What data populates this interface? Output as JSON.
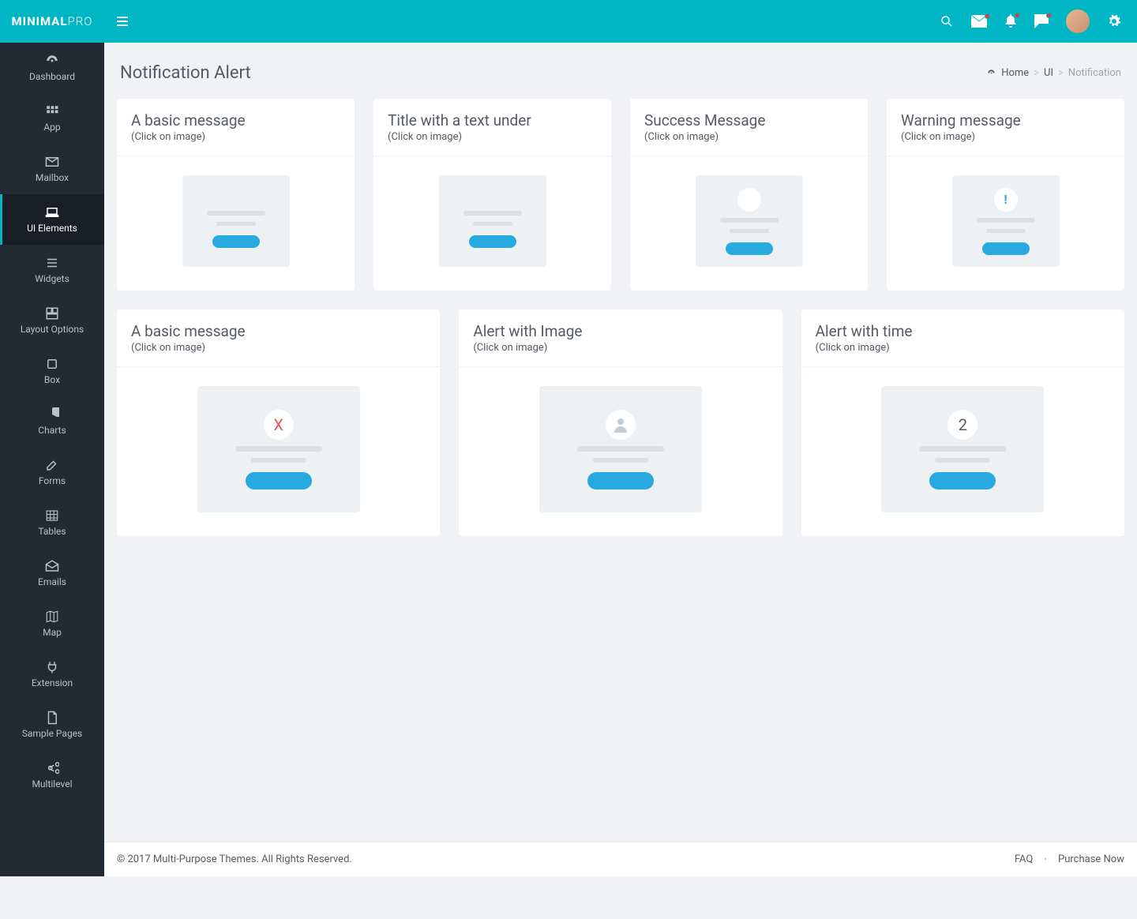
{
  "brand": {
    "part1": "MINIMAL",
    "part2": "PRO"
  },
  "nav": [
    {
      "label": "Dashboard",
      "icon": "dashboard"
    },
    {
      "label": "App",
      "icon": "grid"
    },
    {
      "label": "Mailbox",
      "icon": "envelope"
    },
    {
      "label": "UI Elements",
      "icon": "laptop",
      "active": true
    },
    {
      "label": "Widgets",
      "icon": "bars"
    },
    {
      "label": "Layout Options",
      "icon": "layout"
    },
    {
      "label": "Box",
      "icon": "box"
    },
    {
      "label": "Charts",
      "icon": "pie"
    },
    {
      "label": "Forms",
      "icon": "edit"
    },
    {
      "label": "Tables",
      "icon": "table"
    },
    {
      "label": "Emails",
      "icon": "mailopen"
    },
    {
      "label": "Map",
      "icon": "map"
    },
    {
      "label": "Extension",
      "icon": "plug"
    },
    {
      "label": "Sample Pages",
      "icon": "file"
    },
    {
      "label": "Multilevel",
      "icon": "share"
    }
  ],
  "page": {
    "title": "Notification Alert"
  },
  "breadcrumb": {
    "home": "Home",
    "mid": "UI",
    "leaf": "Notification"
  },
  "cards_row1": [
    {
      "title": "A basic message",
      "sub": "(Click on image)",
      "variant": "plain"
    },
    {
      "title": "Title with a text under",
      "sub": "(Click on image)",
      "variant": "plain"
    },
    {
      "title": "Success Message",
      "sub": "(Click on image)",
      "variant": "circle-blank"
    },
    {
      "title": "Warning message",
      "sub": "(Click on image)",
      "variant": "circle-exclaim"
    }
  ],
  "cards_row2": [
    {
      "title": "A basic message",
      "sub": "(Click on image)",
      "variant": "circle-x"
    },
    {
      "title": "Alert with Image",
      "sub": "(Click on image)",
      "variant": "circle-user"
    },
    {
      "title": "Alert with time",
      "sub": "(Click on image)",
      "variant": "circle-timer",
      "timer": "2"
    }
  ],
  "footer": {
    "copy": "© 2017 Multi-Purpose Themes. All Rights Reserved.",
    "faq": "FAQ",
    "purchase": "Purchase Now"
  }
}
